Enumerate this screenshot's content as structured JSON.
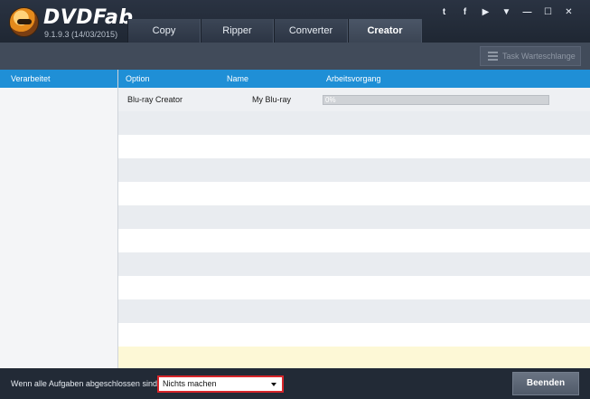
{
  "app": {
    "brand": "DVDFab",
    "version": "9.1.9.3 (14/03/2015)"
  },
  "tabs": [
    {
      "label": "Copy",
      "active": false
    },
    {
      "label": "Ripper",
      "active": false
    },
    {
      "label": "Converter",
      "active": false
    },
    {
      "label": "Creator",
      "active": true
    }
  ],
  "window_buttons": {
    "twitter": "t",
    "facebook": "f",
    "youtube": "▶",
    "menu": "▼",
    "minimize": "—",
    "maximize": "☐",
    "close": "✕"
  },
  "toolbar": {
    "queue_label": "Task Warteschlange"
  },
  "sidebar": {
    "items": [
      {
        "label": "Verarbeitet",
        "selected": true
      }
    ]
  },
  "table": {
    "columns": [
      "Option",
      "Name",
      "Arbeitsvorgang"
    ],
    "rows": [
      {
        "option": "Blu-ray Creator",
        "name": "My Blu-ray",
        "progress_text": "0%",
        "progress": 0
      }
    ]
  },
  "bottombar": {
    "after_label": "Wenn alle Aufgaben abgeschlossen sind:",
    "after_value": "Nichts machen",
    "end_label": "Beenden"
  },
  "colors": {
    "accent": "#1f8fd6",
    "highlight_border": "#d8262b",
    "footer_strip": "#fdf8d6"
  }
}
